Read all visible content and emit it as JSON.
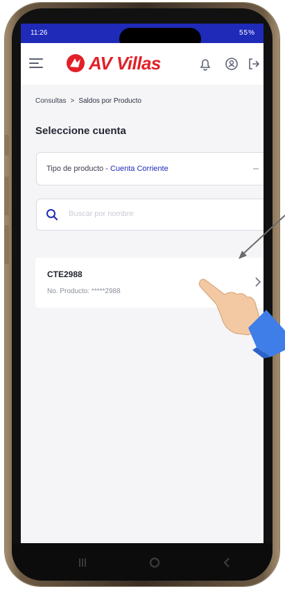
{
  "status_bar": {
    "time": "11:26",
    "right_icons": "55%"
  },
  "header": {
    "menu_icon": "hamburger-menu-icon",
    "logo_text": "AV Villas",
    "logo_icon": "av-villas-logo-icon",
    "icons": [
      "bell-icon",
      "user-circle-icon",
      "logout-icon"
    ]
  },
  "breadcrumb": {
    "parent": "Consultas",
    "separator": ">",
    "current": "Saldos por Producto"
  },
  "page_title": "Seleccione cuenta",
  "product_select": {
    "label": "Tipo de producto -",
    "value": "Cuenta Corriente"
  },
  "search": {
    "placeholder": "Buscar por nombre"
  },
  "account_card": {
    "name": "CTE2988",
    "number": "No. Producto: *****2988"
  },
  "nav_bar": {
    "icons": [
      "recent-apps-icon",
      "home-icon",
      "back-icon"
    ]
  },
  "colors": {
    "brand_red": "#e12028",
    "brand_blue": "#1f2bb8",
    "status_bar": "#1f2bb8"
  }
}
